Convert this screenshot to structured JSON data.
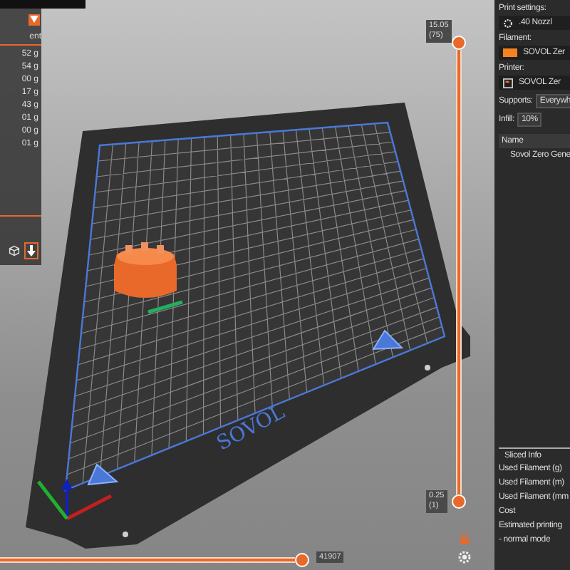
{
  "left_panel": {
    "header": "ent",
    "rows": [
      "52 g",
      "54 g",
      "00 g",
      "17 g",
      "43 g",
      "01 g",
      "00 g",
      "01 g"
    ]
  },
  "bed_logo": "SOVOL",
  "layer_slider": {
    "top": {
      "value": "15.05",
      "layer": "(75)",
      "level": 1
    },
    "bottom": {
      "value": "0.25",
      "layer": "(1)",
      "level": 0
    }
  },
  "move_slider": {
    "reading": "41907",
    "level": 1
  },
  "sidebar": {
    "print_settings": {
      "label": "Print settings:",
      "value": ".40 Nozzl"
    },
    "filament": {
      "label": "Filament:",
      "value": "SOVOL Zer",
      "color": "#f5821f"
    },
    "printer": {
      "label": "Printer:",
      "value": "SOVOL Zer"
    },
    "supports": {
      "label": "Supports:",
      "value": "Everywh"
    },
    "infill": {
      "label": "Infill:",
      "value": "10%"
    },
    "objects": {
      "column": "Name",
      "items": [
        "Sovol Zero Gene"
      ]
    },
    "sliced_info": {
      "title": "Sliced Info",
      "rows": [
        "Used Filament (g)",
        "Used Filament (m)",
        "Used Filament (mm",
        "Cost",
        "Estimated printing",
        "- normal mode"
      ]
    }
  }
}
